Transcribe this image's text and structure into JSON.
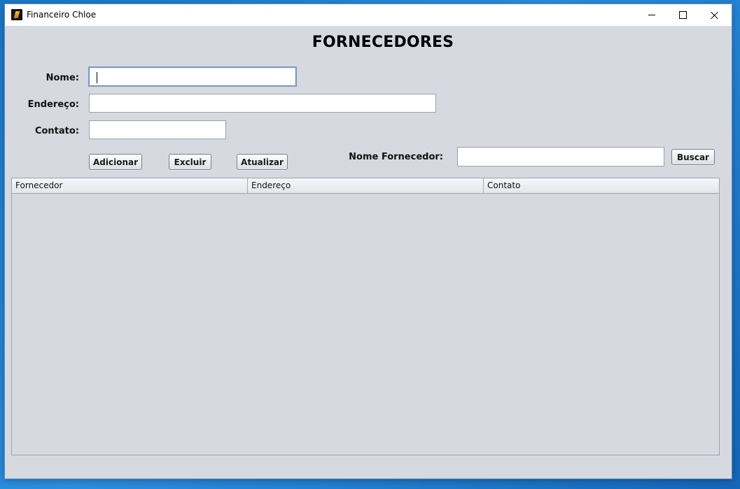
{
  "window": {
    "title": "Financeiro Chloe"
  },
  "page": {
    "heading": "FORNECEDORES"
  },
  "form": {
    "nome_label": "Nome:",
    "nome_value": "",
    "endereco_label": "Endereço:",
    "endereco_value": "",
    "contato_label": "Contato:",
    "contato_value": ""
  },
  "actions": {
    "add_label": "Adicionar",
    "delete_label": "Excluir",
    "update_label": "Atualizar"
  },
  "search": {
    "label": "Nome Fornecedor:",
    "value": "",
    "button_label": "Buscar"
  },
  "table": {
    "columns": [
      "Fornecedor",
      "Endereço",
      "Contato"
    ],
    "rows": []
  },
  "icons": {
    "app": "app-icon",
    "minimize": "minimize-icon",
    "maximize": "maximize-icon",
    "close": "close-icon"
  }
}
